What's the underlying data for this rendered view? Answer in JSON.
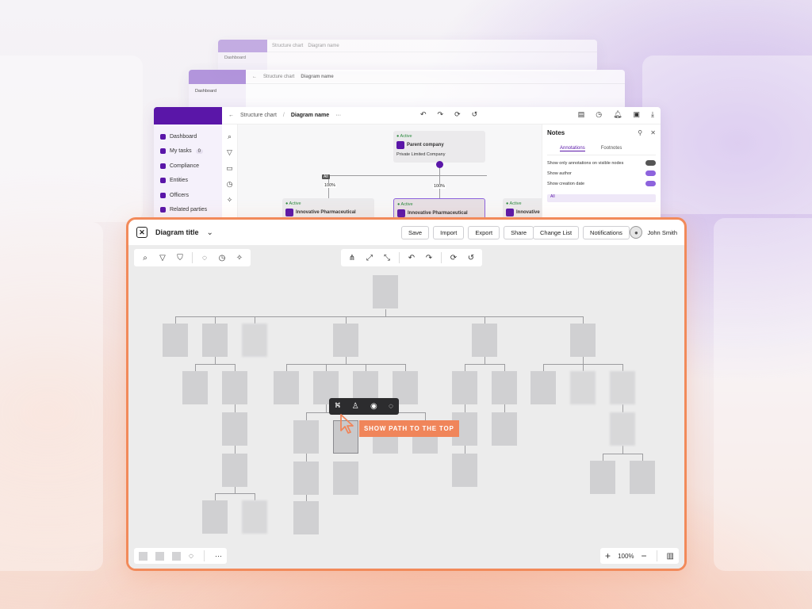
{
  "back_window_1": {
    "breadcrumb": "Structure chart",
    "diagram": "Diagram name",
    "nav": "Dashboard"
  },
  "back_window_2": {
    "breadcrumb": "Structure chart",
    "diagram": "Diagram name",
    "nav": "Dashboard"
  },
  "mid_window": {
    "breadcrumb": "Structure chart",
    "diagram_name": "Diagram name",
    "more": "···",
    "sidebar": [
      {
        "label": "Dashboard"
      },
      {
        "label": "My tasks",
        "count": "0"
      },
      {
        "label": "Compliance"
      },
      {
        "label": "Entities"
      },
      {
        "label": "Officers"
      },
      {
        "label": "Related parties"
      }
    ],
    "parent_card": {
      "status": "Active",
      "name": "Parent company",
      "type": "Private Limited Company"
    },
    "child_card_1": {
      "status": "Active",
      "name": "Innovative Pharmaceutical"
    },
    "child_card_2": {
      "status": "Active",
      "name": "Innovative Pharmaceutical"
    },
    "child_card_3": {
      "status": "Active",
      "name": "Innovative"
    },
    "pct_1": "100%",
    "pct_2": "100%",
    "badge_all": "All",
    "notes": {
      "title": "Notes",
      "tab_annotations": "Annotations",
      "tab_footnotes": "Footnotes",
      "opt_visible": "Show only annotations on visible nodes",
      "opt_author": "Show author",
      "opt_date": "Show creation date",
      "all_label": "All"
    }
  },
  "main": {
    "title": "Diagram title",
    "buttons": [
      "Save",
      "Import",
      "Export",
      "Share"
    ],
    "buttons_right": [
      "Change List",
      "Notifications"
    ],
    "user_name": "John Smith",
    "tooltip": "SHOW PATH TO THE TOP",
    "zoom": "100%",
    "more": "···"
  }
}
